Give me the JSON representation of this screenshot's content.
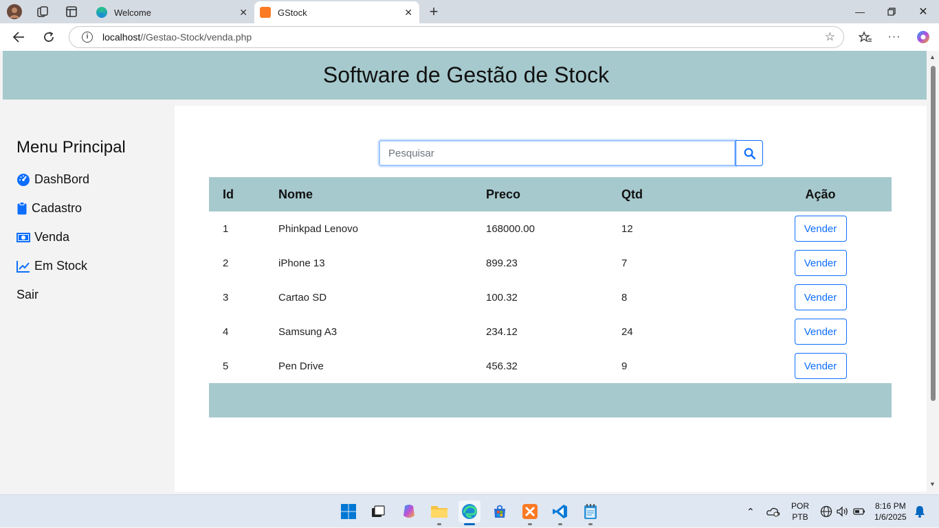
{
  "browser": {
    "tabs": [
      {
        "title": "Welcome",
        "active": false
      },
      {
        "title": "GStock",
        "active": true
      }
    ],
    "url": {
      "host": "localhost",
      "path": "//Gestao-Stock/venda.php"
    }
  },
  "page": {
    "header_title": "Software de Gestão de Stock",
    "menu": {
      "title": "Menu Principal",
      "items": [
        {
          "label": "DashBord",
          "icon": "gauge-icon"
        },
        {
          "label": "Cadastro",
          "icon": "clipboard-icon"
        },
        {
          "label": "Venda",
          "icon": "money-bill-icon"
        },
        {
          "label": "Em Stock",
          "icon": "line-chart-icon"
        },
        {
          "label": "Sair",
          "icon": ""
        }
      ]
    },
    "search": {
      "placeholder": "Pesquisar",
      "value": ""
    },
    "table": {
      "headers": {
        "id": "Id",
        "nome": "Nome",
        "preco": "Preco",
        "qtd": "Qtd",
        "acao": "Ação"
      },
      "action_label": "Vender",
      "rows": [
        {
          "id": "1",
          "nome": "Phinkpad Lenovo",
          "preco": "168000.00",
          "qtd": "12"
        },
        {
          "id": "2",
          "nome": "iPhone 13",
          "preco": "899.23",
          "qtd": "7"
        },
        {
          "id": "3",
          "nome": "Cartao SD",
          "preco": "100.32",
          "qtd": "8"
        },
        {
          "id": "4",
          "nome": "Samsung A3",
          "preco": "234.12",
          "qtd": "24"
        },
        {
          "id": "5",
          "nome": "Pen Drive",
          "preco": "456.32",
          "qtd": "9"
        }
      ]
    }
  },
  "taskbar": {
    "language": {
      "line1": "POR",
      "line2": "PTB"
    },
    "clock": {
      "time": "8:16 PM",
      "date": "1/6/2025"
    }
  },
  "colors": {
    "header_bg": "#a6c9cd",
    "primary": "#0d6efd",
    "sidebar_bg": "#f3f3f3"
  }
}
